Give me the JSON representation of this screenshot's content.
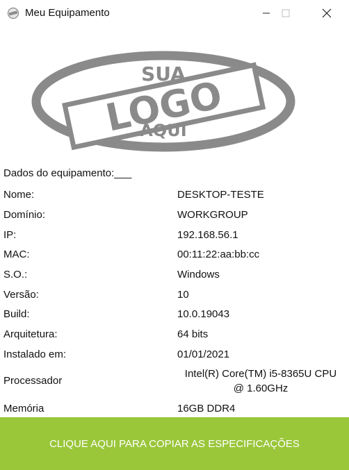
{
  "window": {
    "title": "Meu Equipamento"
  },
  "logo": {
    "top": "SUA",
    "main": "LOGO",
    "bottom": "AQUI",
    "color": "#8a8a8a"
  },
  "section": {
    "heading": "Dados do equipamento:___"
  },
  "specs": [
    {
      "label": "Nome:",
      "value": "DESKTOP-TESTE"
    },
    {
      "label": "Domínio:",
      "value": "WORKGROUP"
    },
    {
      "label": "IP:",
      "value": "192.168.56.1"
    },
    {
      "label": "MAC:",
      "value": "00:11:22:aa:bb:cc"
    },
    {
      "label": "S.O.:",
      "value": "Windows"
    },
    {
      "label": "Versão:",
      "value": "10"
    },
    {
      "label": "Build:",
      "value": "10.0.19043"
    },
    {
      "label": "Arquitetura:",
      "value": "64 bits"
    },
    {
      "label": "Instalado em:",
      "value": "01/01/2021"
    },
    {
      "label": "Processador",
      "value_line1": "Intel(R) Core(TM) i5-8365U CPU",
      "value_line2": "@ 1.60GHz"
    },
    {
      "label": "Memória",
      "value": "16GB DDR4"
    }
  ],
  "copy_button": {
    "label": "CLIQUE AQUI PARA COPIAR AS ESPECIFICAÇÕES",
    "color": "#9ac63a"
  }
}
